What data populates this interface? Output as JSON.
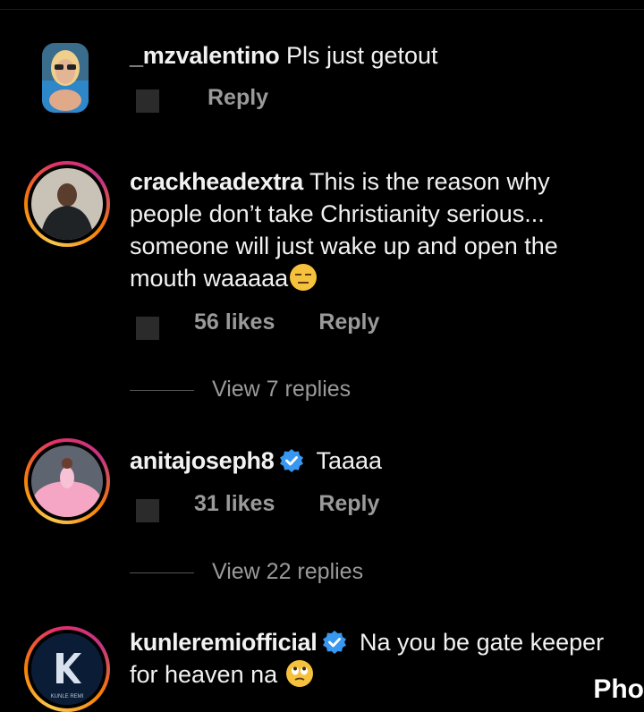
{
  "comments": [
    {
      "username": "_mzvalentino",
      "text": "Pls just getout",
      "reply_label": "Reply",
      "avatar_icon": "user-photo-avatar"
    },
    {
      "username": "crackheadextra",
      "text": "This is the reason why people don’t take Christianity serious... someone will just wake up and open the mouth waaaaa",
      "likes": "56 likes",
      "reply_label": "Reply",
      "view_replies": "View 7 replies",
      "emoji": "expressionless-face-emoji"
    },
    {
      "username": "anitajoseph8",
      "text": "Taaaa",
      "likes": "31 likes",
      "reply_label": "Reply",
      "view_replies": "View 22 replies",
      "verified_icon": "verified-badge-icon"
    },
    {
      "username": "kunleremiofficial",
      "text": "Na you be gate keeper for heaven na",
      "verified_icon": "verified-badge-icon",
      "emoji": "eye-roll-face-emoji",
      "avatar_text": "KUNLE REMI"
    }
  ],
  "corner_text": "Pho",
  "colors": {
    "background": "#000000",
    "text": "#f2f2f2",
    "muted": "#9a9a9a",
    "verified": "#3897f0",
    "story_ring": "#f77f00"
  }
}
